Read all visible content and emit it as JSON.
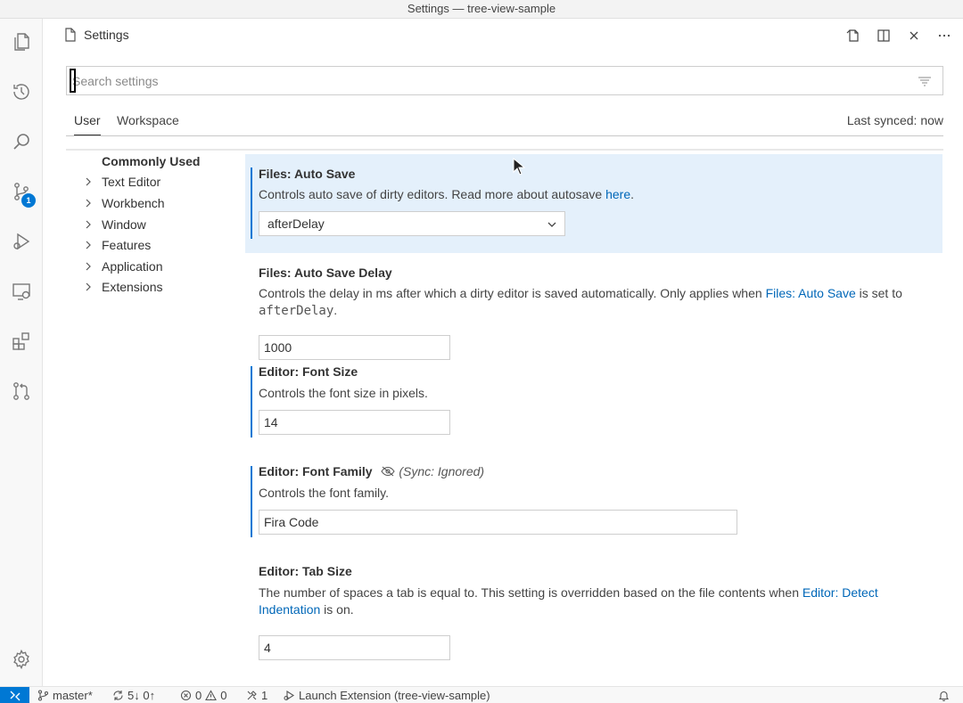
{
  "window": {
    "title": "Settings — tree-view-sample"
  },
  "activity_bar": {
    "items": [
      {
        "icon": "explorer-icon"
      },
      {
        "icon": "timeline-icon"
      },
      {
        "icon": "search-icon"
      },
      {
        "icon": "source-control-icon",
        "badge": "1"
      },
      {
        "icon": "run-debug-icon"
      },
      {
        "icon": "remote-explorer-icon"
      },
      {
        "icon": "extensions-icon"
      },
      {
        "icon": "pull-requests-icon"
      }
    ],
    "bottom_icon": "manage-gear-icon"
  },
  "editor_tab": {
    "title": "Settings"
  },
  "search": {
    "placeholder": "Search settings"
  },
  "scopes": {
    "user": "User",
    "workspace": "Workspace",
    "last_synced": "Last synced: now"
  },
  "toc": {
    "items": [
      {
        "label": "Commonly Used",
        "expandable": false
      },
      {
        "label": "Text Editor",
        "expandable": true
      },
      {
        "label": "Workbench",
        "expandable": true
      },
      {
        "label": "Window",
        "expandable": true
      },
      {
        "label": "Features",
        "expandable": true
      },
      {
        "label": "Application",
        "expandable": true
      },
      {
        "label": "Extensions",
        "expandable": true
      }
    ]
  },
  "settings": {
    "auto_save": {
      "category": "Files: ",
      "name": "Auto Save",
      "desc_prefix": "Controls auto save of dirty editors. Read more about autosave ",
      "desc_link": "here",
      "desc_suffix": ".",
      "value": "afterDelay"
    },
    "auto_save_delay": {
      "category": "Files: ",
      "name": "Auto Save Delay",
      "desc_prefix": "Controls the delay in ms after which a dirty editor is saved automatically. Only applies when ",
      "desc_link": "Files: Auto Save",
      "desc_middle": " is set to ",
      "desc_code": "afterDelay",
      "desc_suffix": ".",
      "value": "1000"
    },
    "font_size": {
      "category": "Editor: ",
      "name": "Font Size",
      "desc": "Controls the font size in pixels.",
      "value": "14"
    },
    "font_family": {
      "category": "Editor: ",
      "name": "Font Family",
      "sync_note": "(Sync: Ignored)",
      "desc": "Controls the font family.",
      "value": "Fira Code"
    },
    "tab_size": {
      "category": "Editor: ",
      "name": "Tab Size",
      "desc_prefix": "The number of spaces a tab is equal to. This setting is overridden based on the file contents when ",
      "desc_link": "Editor: Detect Indentation",
      "desc_suffix": " is on.",
      "value": "4"
    }
  },
  "status_bar": {
    "branch": "master*",
    "sync": "5↓ 0↑",
    "errors": "0",
    "warnings": "0",
    "ports": "1",
    "launch": "Launch Extension (tree-view-sample)"
  },
  "colors": {
    "accent": "#0078d4",
    "link": "#0067b8",
    "focused_row": "#e4f0fb"
  }
}
